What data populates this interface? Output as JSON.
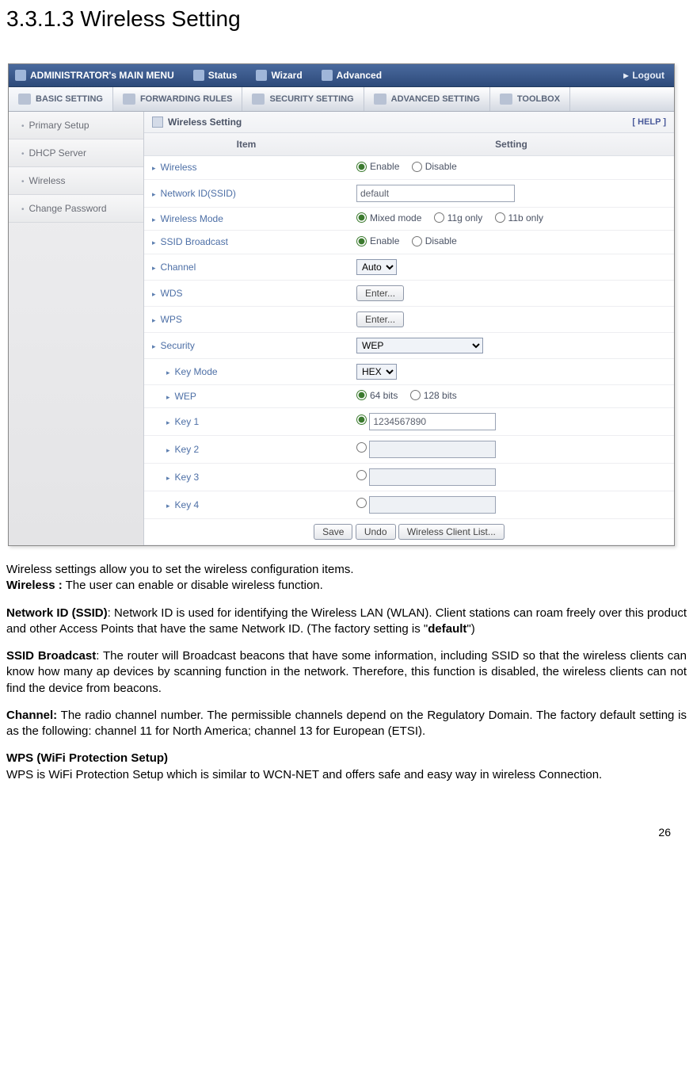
{
  "heading": "3.3.1.3 Wireless Setting",
  "topbar": {
    "admin": "ADMINISTRATOR's MAIN MENU",
    "items": [
      {
        "label": "Status"
      },
      {
        "label": "Wizard"
      },
      {
        "label": "Advanced"
      }
    ],
    "logout": "Logout"
  },
  "tabs": [
    {
      "label": "BASIC SETTING",
      "active": true
    },
    {
      "label": "FORWARDING RULES"
    },
    {
      "label": "SECURITY SETTING"
    },
    {
      "label": "ADVANCED SETTING"
    },
    {
      "label": "TOOLBOX"
    }
  ],
  "sidebar": [
    {
      "label": "Primary Setup"
    },
    {
      "label": "DHCP Server"
    },
    {
      "label": "Wireless"
    },
    {
      "label": "Change Password"
    }
  ],
  "panel": {
    "title": "Wireless Setting",
    "help": "[ HELP ]",
    "headers": {
      "item": "Item",
      "setting": "Setting"
    },
    "rows": {
      "wireless": {
        "label": "Wireless",
        "opt1": "Enable",
        "opt2": "Disable"
      },
      "ssid": {
        "label": "Network ID(SSID)",
        "value": "default"
      },
      "mode": {
        "label": "Wireless Mode",
        "opt1": "Mixed mode",
        "opt2": "11g only",
        "opt3": "11b only"
      },
      "broadcast": {
        "label": "SSID Broadcast",
        "opt1": "Enable",
        "opt2": "Disable"
      },
      "channel": {
        "label": "Channel",
        "value": "Auto"
      },
      "wds": {
        "label": "WDS",
        "btn": "Enter..."
      },
      "wps": {
        "label": "WPS",
        "btn": "Enter..."
      },
      "security": {
        "label": "Security",
        "value": "WEP"
      },
      "keymode": {
        "label": "Key Mode",
        "value": "HEX"
      },
      "wep": {
        "label": "WEP",
        "opt1": "64 bits",
        "opt2": "128 bits"
      },
      "key1": {
        "label": "Key 1",
        "value": "1234567890"
      },
      "key2": {
        "label": "Key 2",
        "value": ""
      },
      "key3": {
        "label": "Key 3",
        "value": ""
      },
      "key4": {
        "label": "Key 4",
        "value": ""
      }
    },
    "buttons": {
      "save": "Save",
      "undo": "Undo",
      "list": "Wireless Client List..."
    }
  },
  "doc": {
    "p1": "Wireless settings allow you to set the wireless configuration items.",
    "p2a": "Wireless :",
    "p2b": " The user can enable or disable wireless function.",
    "p3a": "Network ID (SSID)",
    "p3b": ": Network ID is used for identifying the Wireless LAN (WLAN). Client stations can roam freely over this product and other Access Points that have the same Network ID. (The factory setting is \"",
    "p3c": "default",
    "p3d": "\")",
    "p4a": "SSID Broadcast",
    "p4b": ": The router will Broadcast beacons that have some information, including SSID so that the wireless clients can know how many ap devices by scanning function in the network. Therefore, this function is disabled, the wireless clients can not find the device from beacons.",
    "p5a": "Channel:",
    "p5b": " The radio channel number. The permissible channels depend on the Regulatory Domain. The factory default setting is as the following: channel 11 for North America; channel 13 for European (ETSI).",
    "p6a": "WPS (WiFi Protection Setup)",
    "p6b": "WPS is WiFi Protection Setup which is similar to WCN-NET and offers safe and easy way in wireless Connection."
  },
  "pagenum": "26"
}
